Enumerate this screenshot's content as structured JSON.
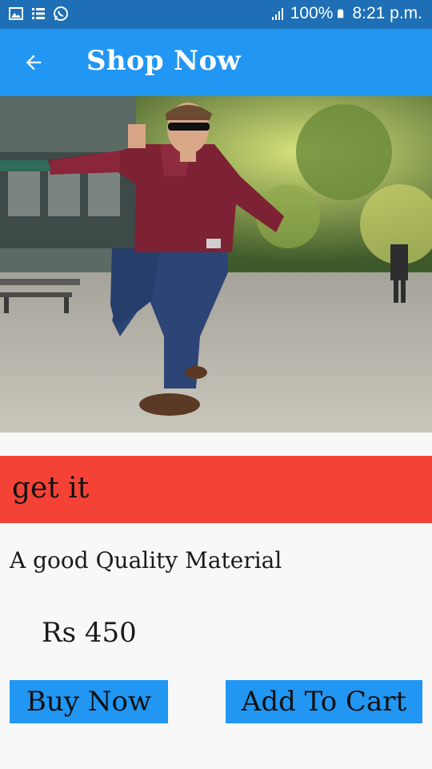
{
  "status_bar": {
    "battery": "100%",
    "time": "8:21 p.m.",
    "icons": [
      "image-icon",
      "list-icon",
      "whatsapp-icon",
      "signal-icon",
      "battery-icon"
    ]
  },
  "app_bar": {
    "title": "Shop Now",
    "back_icon": "arrow-left-icon"
  },
  "product": {
    "banner": "get it",
    "description": "A good Quality Material",
    "price": "Rs 450"
  },
  "actions": {
    "buy_label": "Buy Now",
    "cart_label": "Add To Cart"
  },
  "colors": {
    "status_bar": "#1e6fb5",
    "primary": "#2196f3",
    "banner": "#f44336",
    "background": "#f8f8f8"
  }
}
